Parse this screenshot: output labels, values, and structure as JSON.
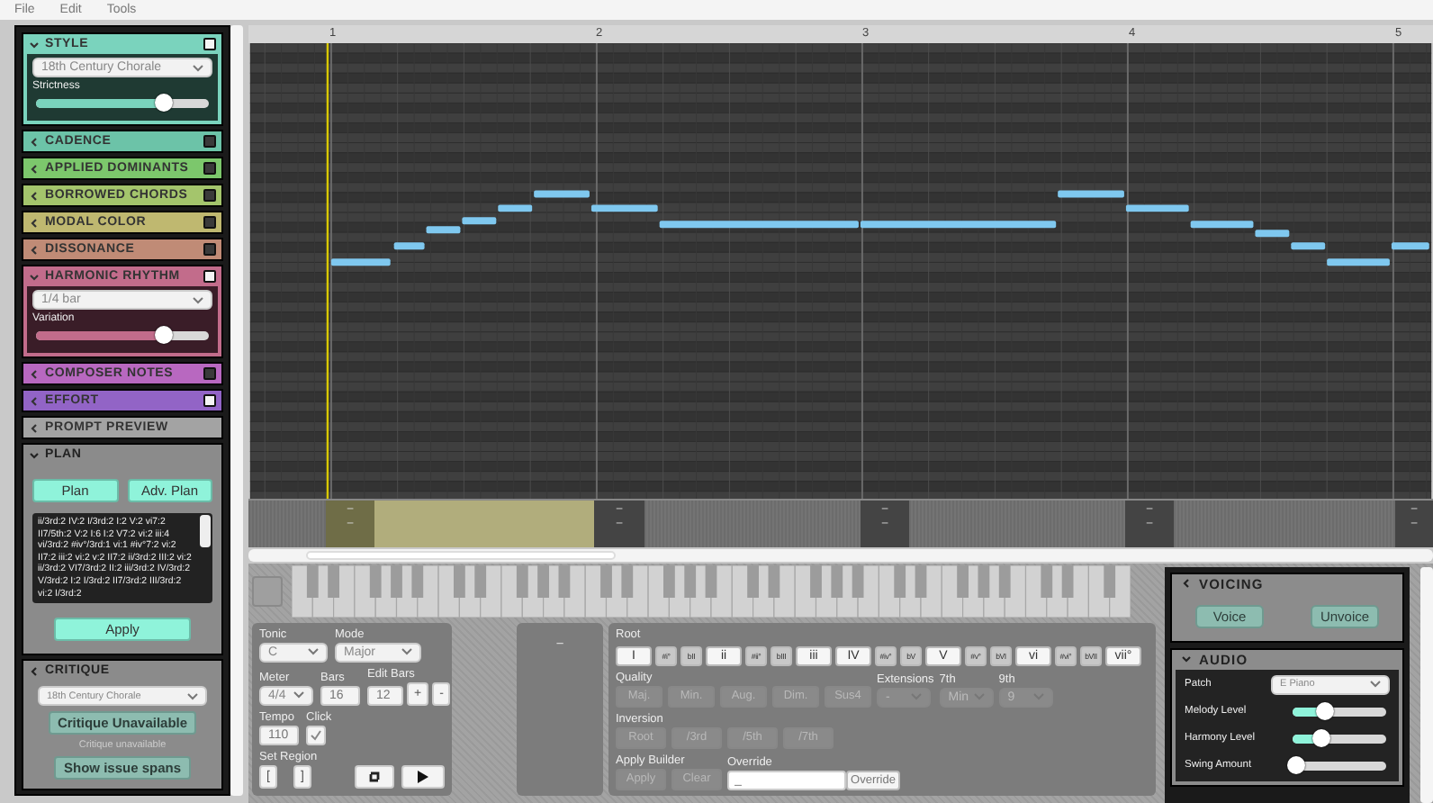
{
  "menu": [
    "File",
    "Edit",
    "Tools"
  ],
  "sections": [
    {
      "kind": "picker",
      "title": "STYLE",
      "color": "#7ad3bd",
      "expanded": true,
      "on": true,
      "select": "18th Century Chorale",
      "slider": {
        "label": "Strictness",
        "level": 0.74
      }
    },
    {
      "kind": "header",
      "title": "CADENCE",
      "color": "#6cc3a8",
      "expanded": false,
      "on": false
    },
    {
      "kind": "header",
      "title": "APPLIED DOMINANTS",
      "color": "#7cc76c",
      "expanded": false,
      "on": false
    },
    {
      "kind": "header",
      "title": "BORROWED CHORDS",
      "color": "#a4c56c",
      "expanded": false,
      "on": false
    },
    {
      "kind": "header",
      "title": "MODAL COLOR",
      "color": "#bfb870",
      "expanded": false,
      "on": false
    },
    {
      "kind": "header",
      "title": "DISSONANCE",
      "color": "#c08b76",
      "expanded": false,
      "on": false
    },
    {
      "kind": "picker",
      "title": "HARMONIC RHYTHM",
      "color": "#c26c8b",
      "expanded": true,
      "on": true,
      "select": "1/4 bar",
      "slider": {
        "label": "Variation",
        "level": 0.74
      }
    },
    {
      "kind": "header",
      "title": "COMPOSER NOTES",
      "color": "#b868c0",
      "expanded": false,
      "on": false
    },
    {
      "kind": "header",
      "title": "EFFORT",
      "color": "#9264c6",
      "expanded": false,
      "on": true
    },
    {
      "kind": "header",
      "title": "PROMPT PREVIEW",
      "color": "#a3a3a3",
      "expanded": false
    },
    {
      "kind": "plan",
      "title": "PLAN",
      "expanded": true,
      "buttons": [
        "Plan",
        "Adv. Plan"
      ],
      "text": "ii/3rd:2 IV:2 I/3rd:2 I:2 V:2 vi7:2 II7/5th:2 V:2 I:6 I:2 V7:2 vi:2 iii:4 vi/3rd:2 #iv°/3rd:1 vi:1 #iv°7:2 vi:2 II7:2 iii:2 vi:2 v:2 II7:2 ii/3rd:2 III:2 vi:2 ii/3rd:2 VI7/3rd:2 II:2 iii/3rd:2 IV/3rd:2 V/3rd:2 I:2 I/3rd:2 II7/3rd:2 III/3rd:2 vi:2 I/3rd:2",
      "apply": "Apply"
    },
    {
      "kind": "critique",
      "title": "CRITIQUE",
      "expanded": false,
      "select": "18th Century Chorale",
      "buttons": [
        "Critique Unavailable",
        "Show issue spans"
      ],
      "status": "Critique unavailable"
    }
  ],
  "ruler": [
    "1",
    "2",
    "3",
    "4",
    "5"
  ],
  "regions": [
    {
      "kind": "span",
      "selected": false
    },
    {
      "kind": "boundary",
      "selected": true,
      "marks": [
        "–",
        "–"
      ]
    },
    {
      "kind": "span",
      "selected": true
    },
    {
      "kind": "boundary",
      "selected": false,
      "marks": [
        "–",
        "–"
      ]
    },
    {
      "kind": "span",
      "selected": false
    },
    {
      "kind": "boundary",
      "selected": false,
      "marks": [
        "–",
        "–"
      ]
    },
    {
      "kind": "span",
      "selected": false
    },
    {
      "kind": "boundary",
      "selected": false,
      "marks": [
        "–",
        "–"
      ]
    },
    {
      "kind": "span",
      "selected": false
    },
    {
      "kind": "boundary",
      "selected": false,
      "marks": [
        "–",
        "–"
      ]
    }
  ],
  "song": {
    "tonic_label": "Tonic",
    "tonic": "C",
    "mode_label": "Mode",
    "mode": "Major",
    "meter_label": "Meter",
    "meter": "4/4",
    "bars_label": "Bars",
    "bars": "16",
    "edit_label": "Edit Bars",
    "edit_bars": "12",
    "plus": "+",
    "minus": "-",
    "tempo_label": "Tempo",
    "tempo": "110",
    "click_label": "Click",
    "click": true,
    "region_label": "Set Region",
    "region_start": "[",
    "region_end": "]"
  },
  "chord_display": "–",
  "builder": {
    "root_label": "Root",
    "roots": [
      {
        "label": "I",
        "kind": "diatonic"
      },
      {
        "label": "#i°",
        "kind": "chromatic"
      },
      {
        "label": "bII",
        "kind": "chromatic"
      },
      {
        "label": "ii",
        "kind": "diatonic"
      },
      {
        "label": "#ii°",
        "kind": "chromatic"
      },
      {
        "label": "bIII",
        "kind": "chromatic"
      },
      {
        "label": "iii",
        "kind": "diatonic"
      },
      {
        "label": "IV",
        "kind": "diatonic"
      },
      {
        "label": "#iv°",
        "kind": "chromatic"
      },
      {
        "label": "bV",
        "kind": "chromatic"
      },
      {
        "label": "V",
        "kind": "diatonic"
      },
      {
        "label": "#v°",
        "kind": "chromatic"
      },
      {
        "label": "bVI",
        "kind": "chromatic"
      },
      {
        "label": "vi",
        "kind": "diatonic"
      },
      {
        "label": "#vi°",
        "kind": "chromatic"
      },
      {
        "label": "bVII",
        "kind": "chromatic"
      },
      {
        "label": "vii°",
        "kind": "diatonic"
      }
    ],
    "quality_label": "Quality",
    "qualities": [
      {
        "label": "Maj.",
        "disabled": true
      },
      {
        "label": "Min.",
        "disabled": true
      },
      {
        "label": "Aug.",
        "disabled": true
      },
      {
        "label": "Dim.",
        "disabled": true
      },
      {
        "label": "Sus4",
        "disabled": true
      }
    ],
    "extensions_label": "Extensions",
    "extensions": "-",
    "seventh_label": "7th",
    "seventh": "Min",
    "ninth_label": "9th",
    "ninth": "9",
    "inversion_label": "Inversion",
    "inversions": [
      {
        "label": "Root",
        "disabled": true
      },
      {
        "label": "/3rd",
        "disabled": true
      },
      {
        "label": "/5th",
        "disabled": true
      },
      {
        "label": "/7th",
        "disabled": true
      }
    ],
    "apply_label": "Apply Builder",
    "apply": "Apply",
    "clear": "Clear",
    "override_label": "Override",
    "override_placeholder": "_",
    "override_button": "Override"
  },
  "voicing": {
    "title": "VOICING",
    "expanded": false,
    "buttons": [
      "Voice",
      "Unvoice"
    ]
  },
  "audio": {
    "title": "AUDIO",
    "expanded": true,
    "patch_label": "Patch",
    "patch": "E Piano",
    "sliders": [
      {
        "label": "Melody Level",
        "level": 0.35
      },
      {
        "label": "Harmony Level",
        "level": 0.3
      },
      {
        "label": "Swing Amount",
        "level": 0.04
      }
    ]
  }
}
